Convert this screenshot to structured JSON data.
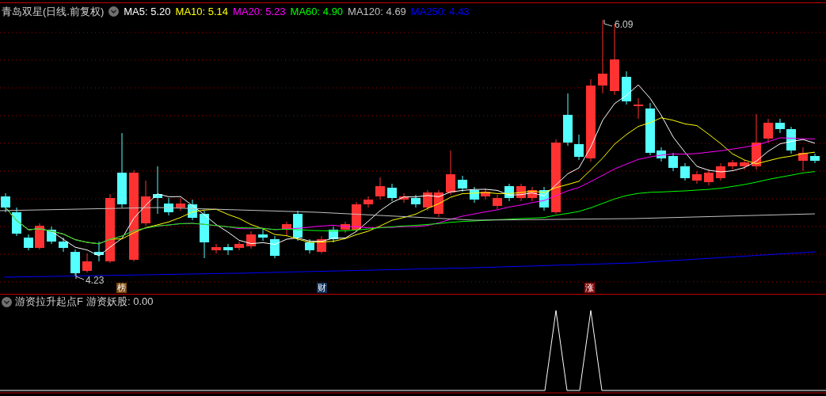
{
  "title": "青岛双星(日线.前复权)",
  "moving_averages": [
    {
      "label": "MA5:",
      "value": "5.20",
      "color": "#ffffff"
    },
    {
      "label": "MA10:",
      "value": "5.14",
      "color": "#ffff00"
    },
    {
      "label": "MA20:",
      "value": "5.23",
      "color": "#ff00ff"
    },
    {
      "label": "MA60:",
      "value": "4.90",
      "color": "#00ff00"
    },
    {
      "label": "MA120:",
      "value": "4.69",
      "color": "#c0c0c0"
    },
    {
      "label": "MA250:",
      "value": "4.43",
      "color": "#0000ff"
    }
  ],
  "price_labels": {
    "high": "6.09",
    "low": "4.23"
  },
  "markers": [
    {
      "text": "榜",
      "color": "#7a4a10"
    },
    {
      "text": "财",
      "color": "#13335e"
    },
    {
      "text": "涨",
      "color": "#8b0a0a"
    }
  ],
  "indicator": {
    "title": "游资拉升起点F",
    "label": "游资妖股:",
    "value": "0.00"
  }
}
